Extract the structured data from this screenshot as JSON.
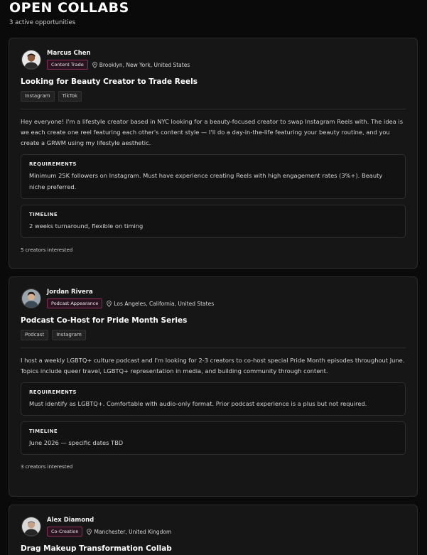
{
  "header": {
    "title": "OPEN COLLABS",
    "subtitle": "3 active opportunities"
  },
  "collabs": [
    {
      "author": "Marcus Chen",
      "type": "Content Trade",
      "location": "Brooklyn, New York, United States",
      "title": "Looking for Beauty Creator to Trade Reels",
      "tags": [
        "Instagram",
        "TikTok"
      ],
      "description": "Hey everyone! I'm a lifestyle creator based in NYC looking for a beauty-focused creator to swap Instagram Reels with. The idea is we each create one reel featuring each other's content style — I'll do a day-in-the-life featuring your beauty routine, and you create a GRWM using my lifestyle aesthetic.",
      "requirements_label": "REQUIREMENTS",
      "requirements": "Minimum 25K followers on Instagram. Must have experience creating Reels with high engagement rates (3%+). Beauty niche preferred.",
      "timeline_label": "TIMELINE",
      "timeline": "2 weeks turnaround, flexible on timing",
      "interested": "5 creators interested"
    },
    {
      "author": "Jordan Rivera",
      "type": "Podcast Appearance",
      "location": "Los Angeles, California, United States",
      "title": "Podcast Co-Host for Pride Month Series",
      "tags": [
        "Podcast",
        "Instagram"
      ],
      "description": "I host a weekly LGBTQ+ culture podcast and I'm looking for 2-3 creators to co-host special Pride Month episodes throughout June. Topics include queer travel, LGBTQ+ representation in media, and building community through content.",
      "requirements_label": "REQUIREMENTS",
      "requirements": "Must identify as LGBTQ+. Comfortable with audio-only format. Prior podcast experience is a plus but not required.",
      "timeline_label": "TIMELINE",
      "timeline": "June 2026 — specific dates TBD",
      "interested": "3 creators interested"
    },
    {
      "author": "Alex Diamond",
      "type": "Co-Creation",
      "location": "Manchester, United Kingdom",
      "title": "Drag Makeup Transformation Collab"
    }
  ]
}
